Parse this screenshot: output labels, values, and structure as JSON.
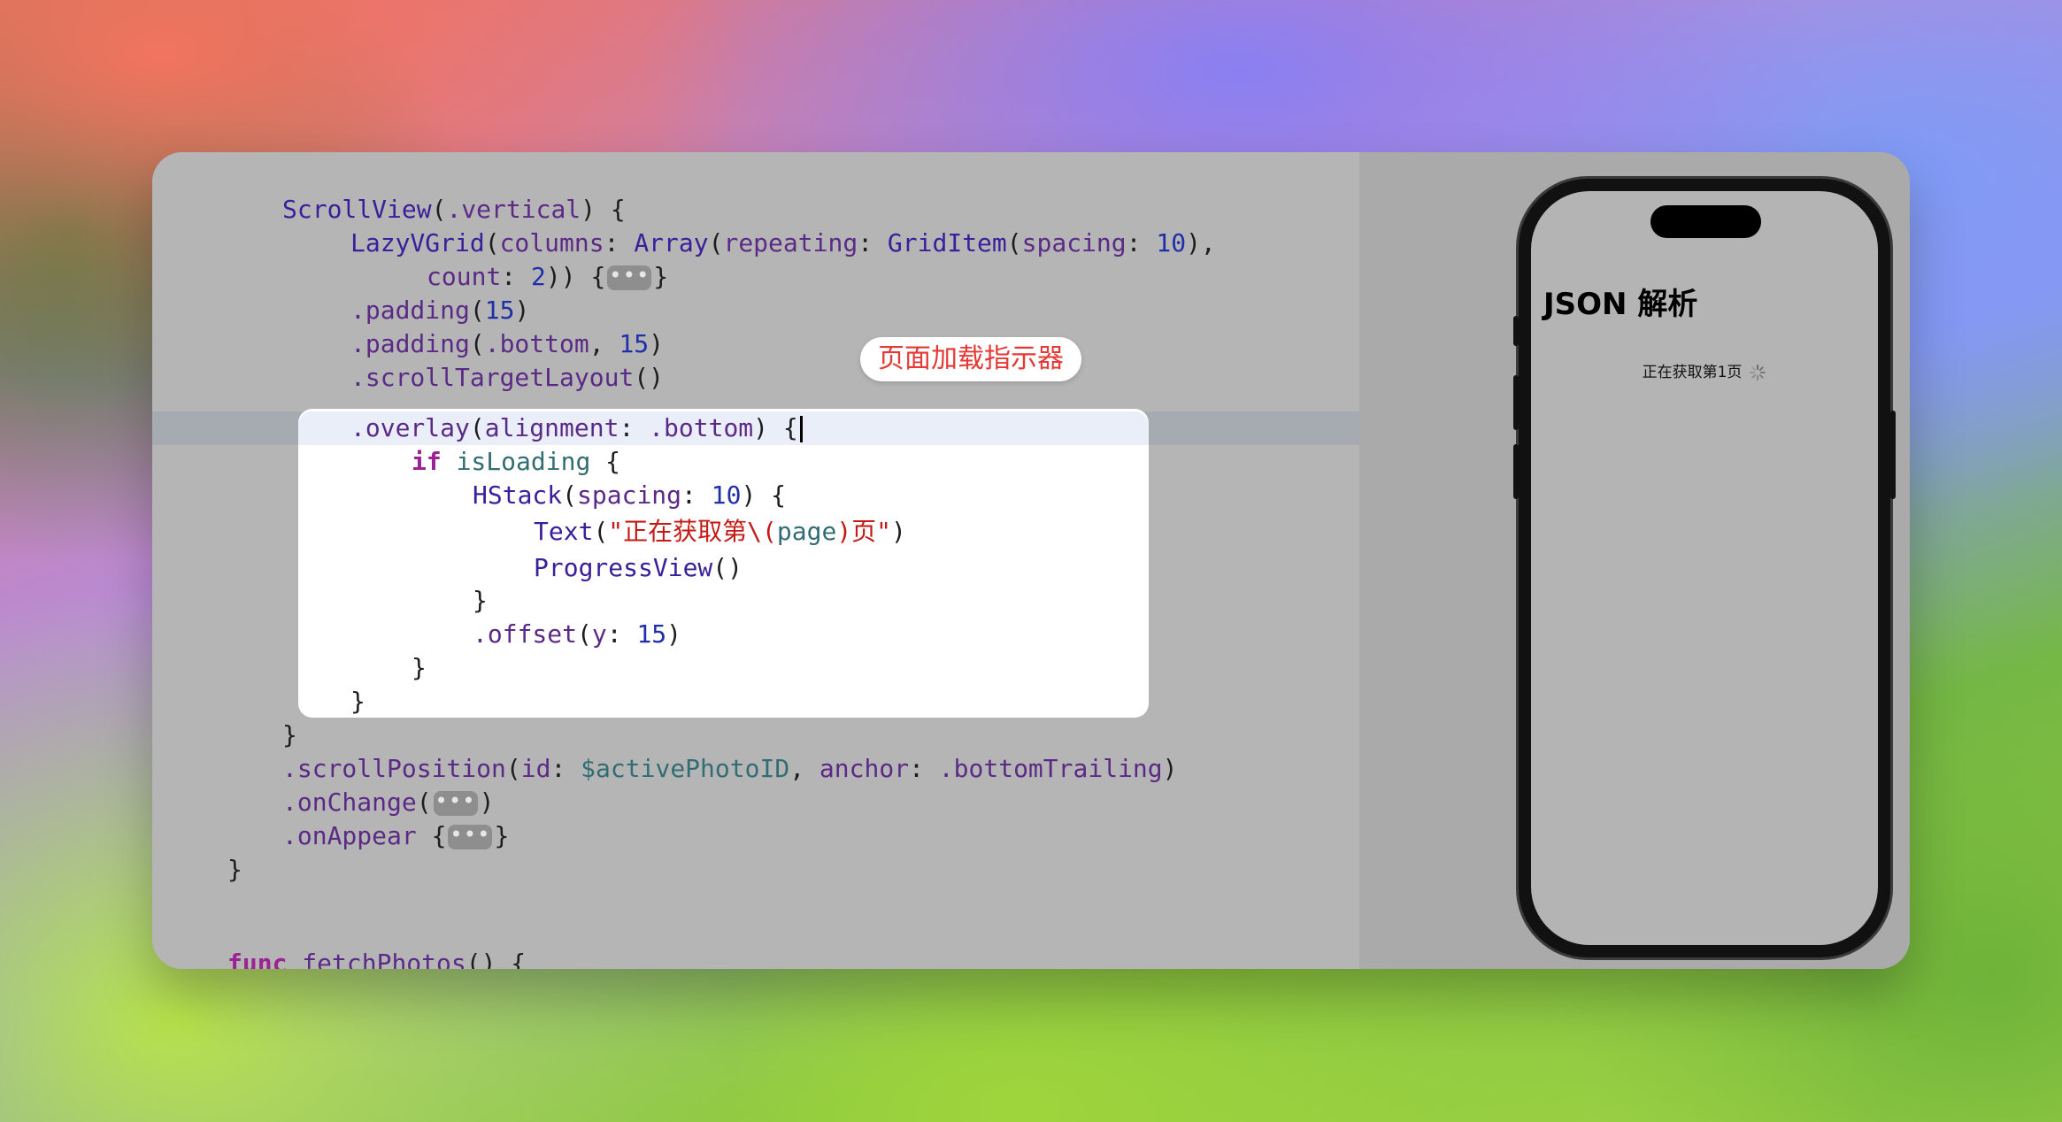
{
  "badge": {
    "label": "页面加载指示器"
  },
  "code": {
    "scroll_view": "ScrollView",
    "vertical": ".vertical",
    "lazy_grid": "LazyVGrid",
    "columns": "columns",
    "array": "Array",
    "repeating": "repeating",
    "grid_item": "GridItem",
    "spacing": "spacing",
    "count": "count",
    "padding": ".padding",
    "bottom": ".bottom",
    "scroll_target_layout": ".scrollTargetLayout",
    "overlay": ".overlay",
    "alignment": "alignment",
    "if_kw": "if",
    "is_loading": "isLoading",
    "hstack": "HStack",
    "text_fn": "Text",
    "text_str_a": "\"正在获取第\\(",
    "page_var": "page",
    "text_str_b": ")页\"",
    "progress_view": "ProgressView",
    "offset": ".offset",
    "y": "y",
    "scroll_position": ".scrollPosition",
    "id": "id",
    "active_photo_id": "$activePhotoID",
    "anchor": "anchor",
    "bottom_trailing": ".bottomTrailing",
    "on_change": ".onChange",
    "on_appear": ".onAppear",
    "func_kw": "func",
    "fetch_photos": "fetchPhotos",
    "fold_marker": "•••",
    "n10": "10",
    "n2": "2",
    "n15": "15"
  },
  "preview": {
    "app_title": "JSON 解析",
    "loading_text": "正在获取第1页"
  }
}
